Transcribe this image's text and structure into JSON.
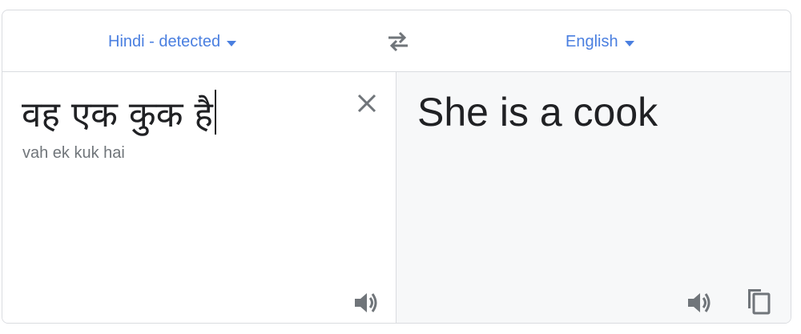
{
  "header": {
    "source_language": "Hindi - detected",
    "target_language": "English"
  },
  "source": {
    "text": "वह एक कुक है",
    "transliteration": "vah ek kuk hai"
  },
  "target": {
    "text": "She is a cook"
  },
  "icons": {
    "swap": "swap-icon",
    "clear": "close-icon",
    "speaker": "speaker-icon",
    "copy": "copy-icon"
  },
  "colors": {
    "accent": "#4a7fe0",
    "icon": "#70757a",
    "border": "#dadce0",
    "target_bg": "#f7f8f9",
    "text": "#202124"
  }
}
